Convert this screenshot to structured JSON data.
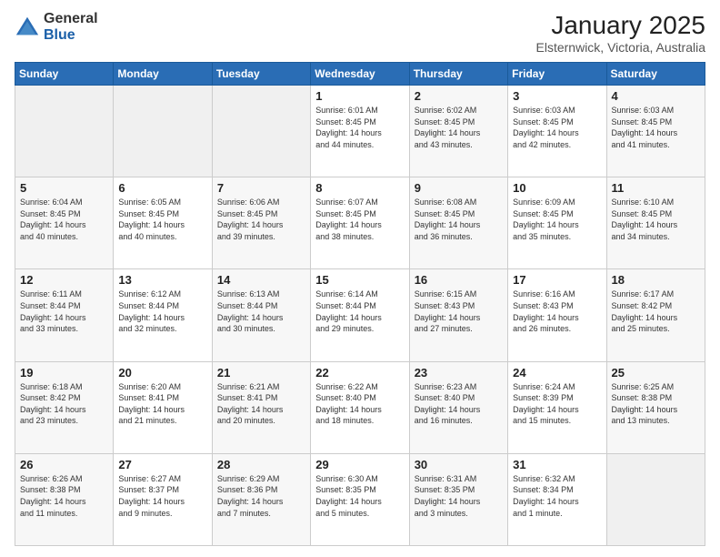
{
  "logo": {
    "general": "General",
    "blue": "Blue"
  },
  "title": {
    "month": "January 2025",
    "location": "Elsternwick, Victoria, Australia"
  },
  "weekdays": [
    "Sunday",
    "Monday",
    "Tuesday",
    "Wednesday",
    "Thursday",
    "Friday",
    "Saturday"
  ],
  "weeks": [
    [
      {
        "day": "",
        "info": ""
      },
      {
        "day": "",
        "info": ""
      },
      {
        "day": "",
        "info": ""
      },
      {
        "day": "1",
        "info": "Sunrise: 6:01 AM\nSunset: 8:45 PM\nDaylight: 14 hours\nand 44 minutes."
      },
      {
        "day": "2",
        "info": "Sunrise: 6:02 AM\nSunset: 8:45 PM\nDaylight: 14 hours\nand 43 minutes."
      },
      {
        "day": "3",
        "info": "Sunrise: 6:03 AM\nSunset: 8:45 PM\nDaylight: 14 hours\nand 42 minutes."
      },
      {
        "day": "4",
        "info": "Sunrise: 6:03 AM\nSunset: 8:45 PM\nDaylight: 14 hours\nand 41 minutes."
      }
    ],
    [
      {
        "day": "5",
        "info": "Sunrise: 6:04 AM\nSunset: 8:45 PM\nDaylight: 14 hours\nand 40 minutes."
      },
      {
        "day": "6",
        "info": "Sunrise: 6:05 AM\nSunset: 8:45 PM\nDaylight: 14 hours\nand 40 minutes."
      },
      {
        "day": "7",
        "info": "Sunrise: 6:06 AM\nSunset: 8:45 PM\nDaylight: 14 hours\nand 39 minutes."
      },
      {
        "day": "8",
        "info": "Sunrise: 6:07 AM\nSunset: 8:45 PM\nDaylight: 14 hours\nand 38 minutes."
      },
      {
        "day": "9",
        "info": "Sunrise: 6:08 AM\nSunset: 8:45 PM\nDaylight: 14 hours\nand 36 minutes."
      },
      {
        "day": "10",
        "info": "Sunrise: 6:09 AM\nSunset: 8:45 PM\nDaylight: 14 hours\nand 35 minutes."
      },
      {
        "day": "11",
        "info": "Sunrise: 6:10 AM\nSunset: 8:45 PM\nDaylight: 14 hours\nand 34 minutes."
      }
    ],
    [
      {
        "day": "12",
        "info": "Sunrise: 6:11 AM\nSunset: 8:44 PM\nDaylight: 14 hours\nand 33 minutes."
      },
      {
        "day": "13",
        "info": "Sunrise: 6:12 AM\nSunset: 8:44 PM\nDaylight: 14 hours\nand 32 minutes."
      },
      {
        "day": "14",
        "info": "Sunrise: 6:13 AM\nSunset: 8:44 PM\nDaylight: 14 hours\nand 30 minutes."
      },
      {
        "day": "15",
        "info": "Sunrise: 6:14 AM\nSunset: 8:44 PM\nDaylight: 14 hours\nand 29 minutes."
      },
      {
        "day": "16",
        "info": "Sunrise: 6:15 AM\nSunset: 8:43 PM\nDaylight: 14 hours\nand 27 minutes."
      },
      {
        "day": "17",
        "info": "Sunrise: 6:16 AM\nSunset: 8:43 PM\nDaylight: 14 hours\nand 26 minutes."
      },
      {
        "day": "18",
        "info": "Sunrise: 6:17 AM\nSunset: 8:42 PM\nDaylight: 14 hours\nand 25 minutes."
      }
    ],
    [
      {
        "day": "19",
        "info": "Sunrise: 6:18 AM\nSunset: 8:42 PM\nDaylight: 14 hours\nand 23 minutes."
      },
      {
        "day": "20",
        "info": "Sunrise: 6:20 AM\nSunset: 8:41 PM\nDaylight: 14 hours\nand 21 minutes."
      },
      {
        "day": "21",
        "info": "Sunrise: 6:21 AM\nSunset: 8:41 PM\nDaylight: 14 hours\nand 20 minutes."
      },
      {
        "day": "22",
        "info": "Sunrise: 6:22 AM\nSunset: 8:40 PM\nDaylight: 14 hours\nand 18 minutes."
      },
      {
        "day": "23",
        "info": "Sunrise: 6:23 AM\nSunset: 8:40 PM\nDaylight: 14 hours\nand 16 minutes."
      },
      {
        "day": "24",
        "info": "Sunrise: 6:24 AM\nSunset: 8:39 PM\nDaylight: 14 hours\nand 15 minutes."
      },
      {
        "day": "25",
        "info": "Sunrise: 6:25 AM\nSunset: 8:38 PM\nDaylight: 14 hours\nand 13 minutes."
      }
    ],
    [
      {
        "day": "26",
        "info": "Sunrise: 6:26 AM\nSunset: 8:38 PM\nDaylight: 14 hours\nand 11 minutes."
      },
      {
        "day": "27",
        "info": "Sunrise: 6:27 AM\nSunset: 8:37 PM\nDaylight: 14 hours\nand 9 minutes."
      },
      {
        "day": "28",
        "info": "Sunrise: 6:29 AM\nSunset: 8:36 PM\nDaylight: 14 hours\nand 7 minutes."
      },
      {
        "day": "29",
        "info": "Sunrise: 6:30 AM\nSunset: 8:35 PM\nDaylight: 14 hours\nand 5 minutes."
      },
      {
        "day": "30",
        "info": "Sunrise: 6:31 AM\nSunset: 8:35 PM\nDaylight: 14 hours\nand 3 minutes."
      },
      {
        "day": "31",
        "info": "Sunrise: 6:32 AM\nSunset: 8:34 PM\nDaylight: 14 hours\nand 1 minute."
      },
      {
        "day": "",
        "info": ""
      }
    ]
  ]
}
